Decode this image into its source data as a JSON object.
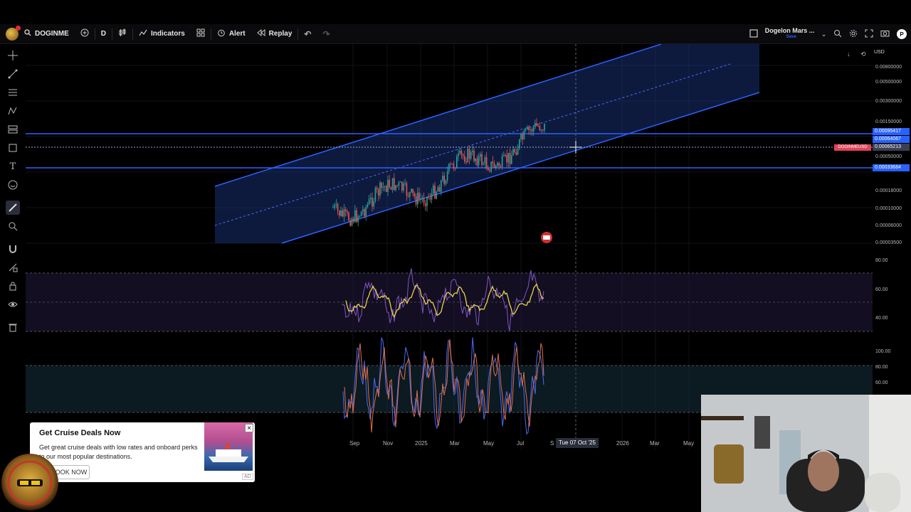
{
  "toolbar": {
    "symbol": "DOGINME",
    "interval": "D",
    "indicators_label": "Indicators",
    "alert_label": "Alert",
    "replay_label": "Replay",
    "layout_name": "Dogelon Mars ...",
    "layout_sub": "Save"
  },
  "price_scale": {
    "currency": "USD",
    "labels": [
      "0.00800000",
      "0.00500000",
      "0.00300000",
      "0.00150000",
      "0.00050000",
      "0.00018000",
      "0.00010000",
      "0.00006000",
      "0.00003500",
      "80.00",
      "60.00",
      "40.00",
      "100.00",
      "80.00",
      "60.00"
    ],
    "tags": [
      {
        "text": "0.00095417",
        "color": "#2962ff"
      },
      {
        "text": "0.00064067",
        "color": "#2962ff"
      },
      {
        "text": "0.00065213",
        "color": "#3b3f52"
      },
      {
        "text": "0.00033684",
        "color": "#2962ff"
      }
    ],
    "symbol_tag": "DOGINMEUSD"
  },
  "time_axis": {
    "labels": [
      "Sep",
      "Nov",
      "2025",
      "Mar",
      "May",
      "Jul",
      "S",
      "2026",
      "Mar",
      "May"
    ],
    "cursor_label": "Tue 07 Oct '25"
  },
  "ad": {
    "title": "Get Cruise Deals Now",
    "description": "Get great cruise deals with low rates and onboard perks to our most popular destinations.",
    "button": "BOOK NOW",
    "close": "×",
    "tag": "AD"
  },
  "colors": {
    "channel_blue": "#2962ff",
    "rsi_purple": "#7e57c2",
    "rsi_yellow": "#e8d44d",
    "stoch_blue": "#4a6cf7",
    "stoch_orange": "#e06f4a",
    "up_green": "#26a69a",
    "down_red": "#ef5350"
  },
  "icons": [
    "crosshair-icon",
    "trendline-icon",
    "fib-icon",
    "pattern-icon",
    "forecast-icon",
    "shape-icon",
    "text-icon",
    "emoji-icon",
    "ruler-icon",
    "zoom-icon",
    "magnet-icon",
    "lock-drawing-icon",
    "lock-icon",
    "eye-icon",
    "trash-icon"
  ]
}
